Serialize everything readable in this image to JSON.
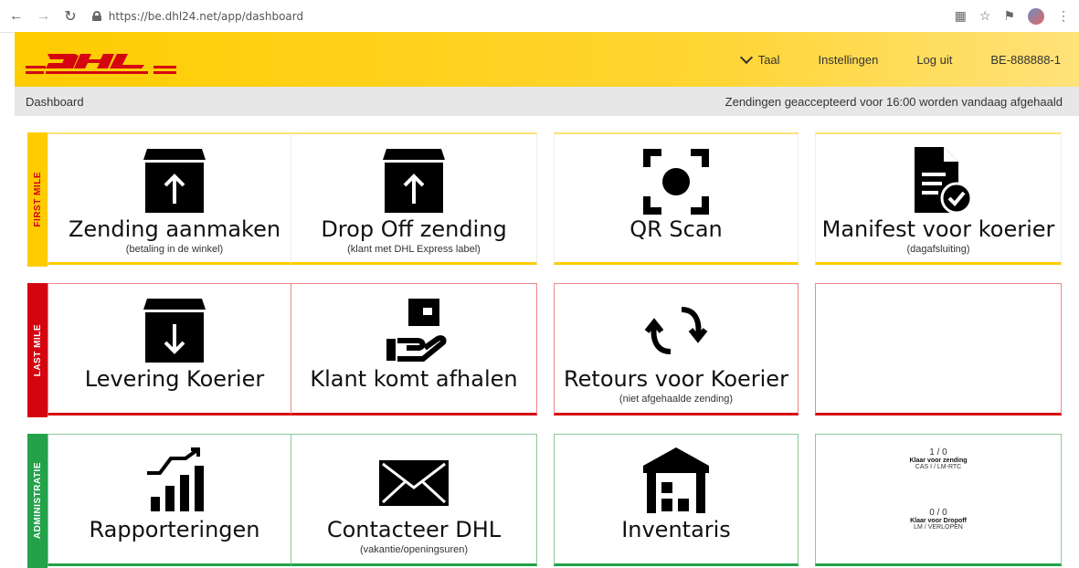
{
  "browser": {
    "url": "https://be.dhl24.net/app/dashboard"
  },
  "header": {
    "logo_text": "DHL",
    "language": "Taal",
    "settings": "Instellingen",
    "logout": "Log uit",
    "account": "BE-888888-1"
  },
  "breadcrumb": {
    "current": "Dashboard",
    "notice": "Zendingen geaccepteerd voor 16:00 worden vandaag afgehaald"
  },
  "colors": {
    "brand_yellow": "#ffcc00",
    "brand_red": "#d40511",
    "admin_green": "#23a24a"
  },
  "sections": {
    "first_mile": {
      "label": "FIRST MILE",
      "tiles": [
        {
          "icon": "box-upload-icon",
          "title": "Zending aanmaken",
          "subtitle": "(betaling in de winkel)"
        },
        {
          "icon": "box-upload-icon",
          "title": "Drop Off zending",
          "subtitle": "(klant met DHL Express label)"
        },
        {
          "icon": "qr-scan-icon",
          "title": "QR Scan",
          "subtitle": ""
        },
        {
          "icon": "manifest-check-icon",
          "title": "Manifest voor koerier",
          "subtitle": "(dagafsluiting)"
        }
      ]
    },
    "last_mile": {
      "label": "LAST MILE",
      "tiles": [
        {
          "icon": "box-download-icon",
          "title": "Levering Koerier",
          "subtitle": ""
        },
        {
          "icon": "hand-package-icon",
          "title": "Klant komt afhalen",
          "subtitle": ""
        },
        {
          "icon": "return-arrows-icon",
          "title": "Retours voor Koerier",
          "subtitle": "(niet afgehaalde zending)"
        }
      ]
    },
    "administratie": {
      "label": "ADMINISTRATIE",
      "tiles": [
        {
          "icon": "report-chart-icon",
          "title": "Rapporteringen",
          "subtitle": ""
        },
        {
          "icon": "envelope-icon",
          "title": "Contacteer DHL",
          "subtitle": "(vakantie/openingsuren)"
        },
        {
          "icon": "warehouse-icon",
          "title": "Inventaris",
          "subtitle": ""
        }
      ],
      "stats": [
        {
          "count": "1 / 0",
          "label": "Klaar voor zending",
          "sublabel": "CAS I / LM-RTC"
        },
        {
          "count": "0 / 0",
          "label": "Klaar voor Dropoff",
          "sublabel": "LM / VERLOPEN"
        }
      ]
    }
  }
}
